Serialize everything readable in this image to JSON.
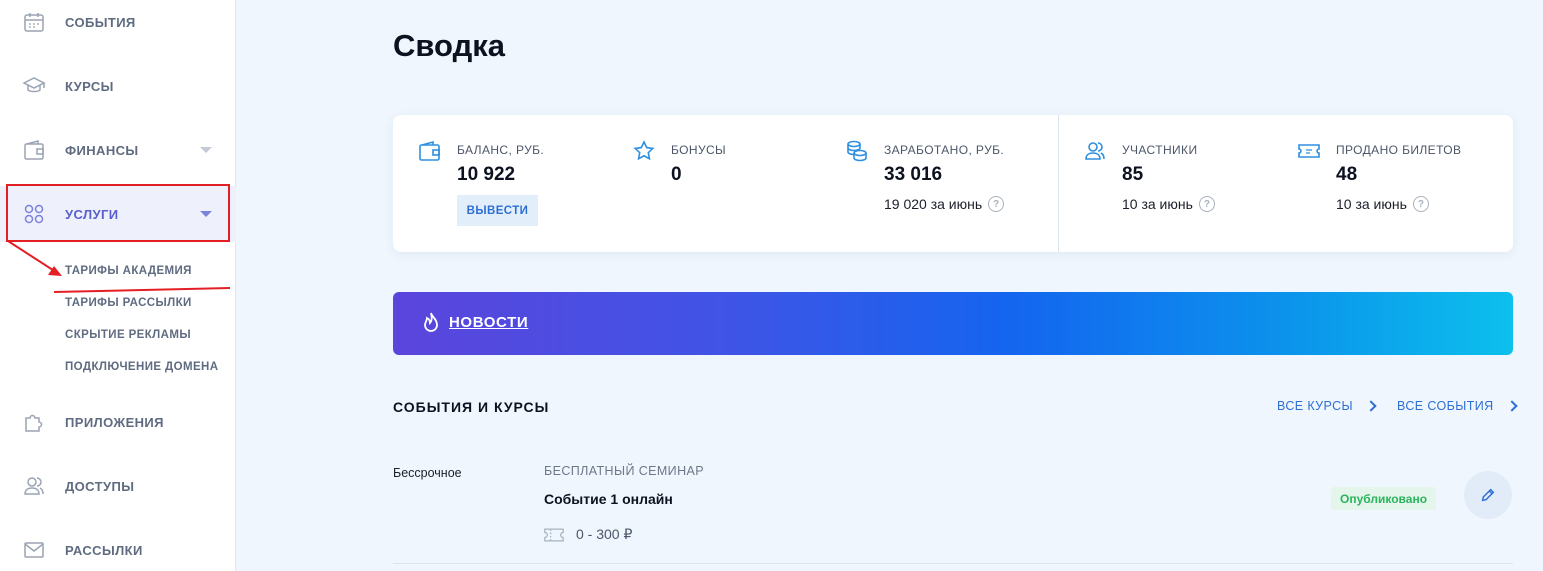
{
  "sidebar": {
    "items": [
      {
        "label": "СОБЫТИЯ",
        "icon": "calendar-icon"
      },
      {
        "label": "КУРСЫ",
        "icon": "graduation-cap-icon"
      },
      {
        "label": "ФИНАНСЫ",
        "icon": "wallet-icon",
        "expandable": true
      },
      {
        "label": "УСЛУГИ",
        "icon": "grid-circles-icon",
        "expandable": true,
        "active": true
      },
      {
        "label": "ПРИЛОЖЕНИЯ",
        "icon": "puzzle-icon"
      },
      {
        "label": "ДОСТУПЫ",
        "icon": "users-icon"
      },
      {
        "label": "РАССЫЛКИ",
        "icon": "mail-icon"
      }
    ],
    "sub_items": [
      "ТАРИФЫ АКАДЕМИЯ",
      "ТАРИФЫ РАССЫЛКИ",
      "СКРЫТИЕ РЕКЛАМЫ",
      "ПОДКЛЮЧЕНИЕ ДОМЕНА"
    ]
  },
  "page": {
    "title": "Сводка"
  },
  "stats": {
    "balance": {
      "label": "БАЛАНС, РУБ.",
      "value": "10 922",
      "button": "ВЫВЕСТИ",
      "icon": "wallet-icon"
    },
    "bonuses": {
      "label": "БОНУСЫ",
      "value": "0",
      "icon": "star-icon"
    },
    "earned": {
      "label": "ЗАРАБОТАНО, РУБ.",
      "value": "33 016",
      "sub": "19 020 за июнь",
      "icon": "coins-icon"
    },
    "participants": {
      "label": "УЧАСТНИКИ",
      "value": "85",
      "sub": "10 за июнь",
      "icon": "users-icon"
    },
    "tickets": {
      "label": "ПРОДАНО БИЛЕТОВ",
      "value": "48",
      "sub": "10 за июнь",
      "icon": "ticket-icon"
    }
  },
  "news": {
    "label": "НОВОСТИ",
    "icon": "flame-icon"
  },
  "events_section": {
    "title": "СОБЫТИЯ И КУРСЫ",
    "all_courses": "ВСЕ КУРСЫ",
    "all_events": "ВСЕ СОБЫТИЯ",
    "rows": [
      {
        "date": "Бессрочное",
        "type": "БЕСПЛАТНЫЙ СЕМИНАР",
        "name": "Событие 1 онлайн",
        "price": "0 - 300 ₽",
        "status": "Опубликовано"
      }
    ]
  },
  "colors": {
    "accent": "#2e6fd4",
    "active_nav": "#5a5fce",
    "annotation": "#e41e25",
    "published": "#2bb45d"
  }
}
